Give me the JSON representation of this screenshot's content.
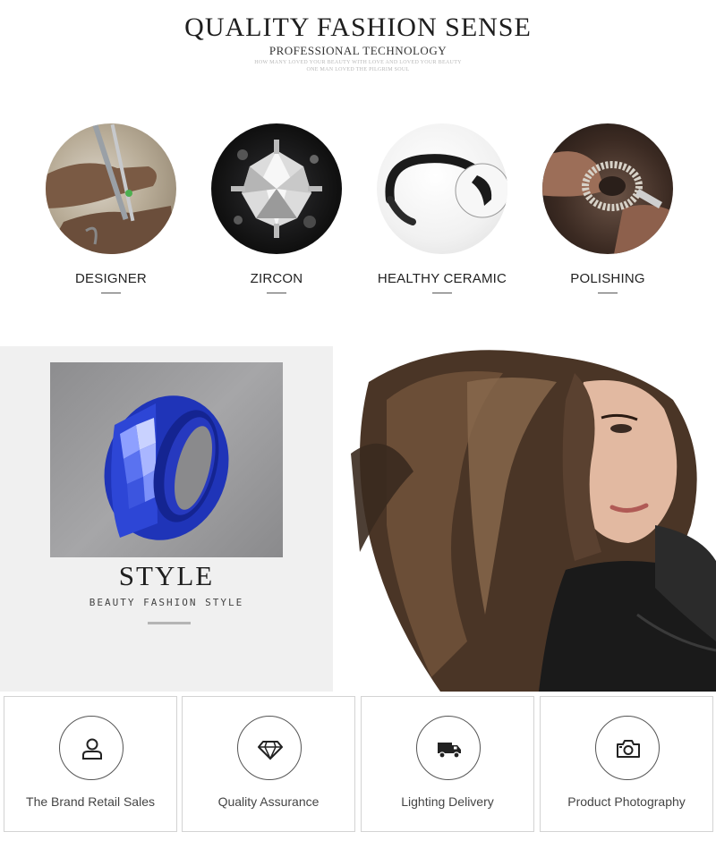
{
  "header": {
    "title": "QUALITY FASHION SENSE",
    "subtitle": "PROFESSIONAL TECHNOLOGY",
    "tagline_1": "HOW MANY LOVED YOUR BEAUTY WITH LOVE AND LOVED YOUR BEAUTY",
    "tagline_2": "ONE MAN LOVED THE PILGRIM SOUL"
  },
  "features": [
    {
      "label": "DESIGNER",
      "icon": "designer-photo"
    },
    {
      "label": "ZIRCON",
      "icon": "zircon-photo"
    },
    {
      "label": "HEALTHY CERAMIC",
      "icon": "ceramic-ring-photo"
    },
    {
      "label": "POLISHING",
      "icon": "polishing-photo"
    }
  ],
  "style_banner": {
    "title": "STYLE",
    "subtitle": "BEAUTY FASHION STYLE",
    "ring_color": "#2a3fc4"
  },
  "services": [
    {
      "label": "The Brand Retail Sales",
      "icon": "user-icon"
    },
    {
      "label": "Quality Assurance",
      "icon": "diamond-icon"
    },
    {
      "label": "Lighting Delivery",
      "icon": "truck-icon"
    },
    {
      "label": "Product Photography",
      "icon": "camera-icon"
    }
  ]
}
